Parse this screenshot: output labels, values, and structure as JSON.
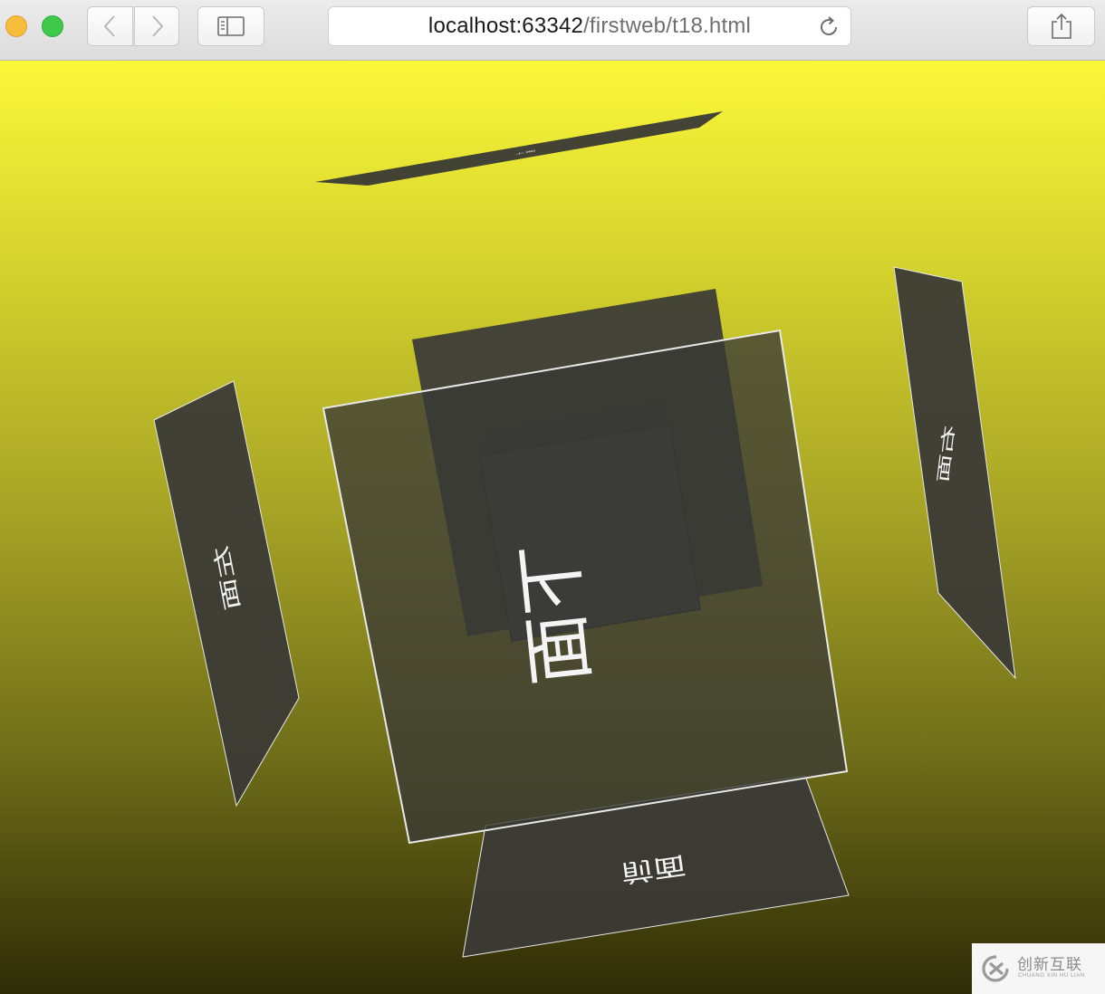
{
  "browser": {
    "url_host": "localhost:63342",
    "url_path": "/firstweb/t18.html",
    "back_icon": "chevron-left-icon",
    "forward_icon": "chevron-right-icon",
    "sidebar_icon": "sidebar-icon",
    "share_icon": "share-icon",
    "reload_icon": "reload-icon"
  },
  "scene": {
    "background_top": "#fbf83a",
    "background_bottom": "#2e2c06",
    "face_color": "#3a3a36",
    "faces": {
      "bottom_label": "下面",
      "left_label": "左面",
      "right_label": "右面",
      "front_label": "前面",
      "top_label": "上面"
    }
  },
  "watermark": {
    "brand": "创新互联",
    "subtitle": "CHUANG XIN HU LIAN"
  }
}
